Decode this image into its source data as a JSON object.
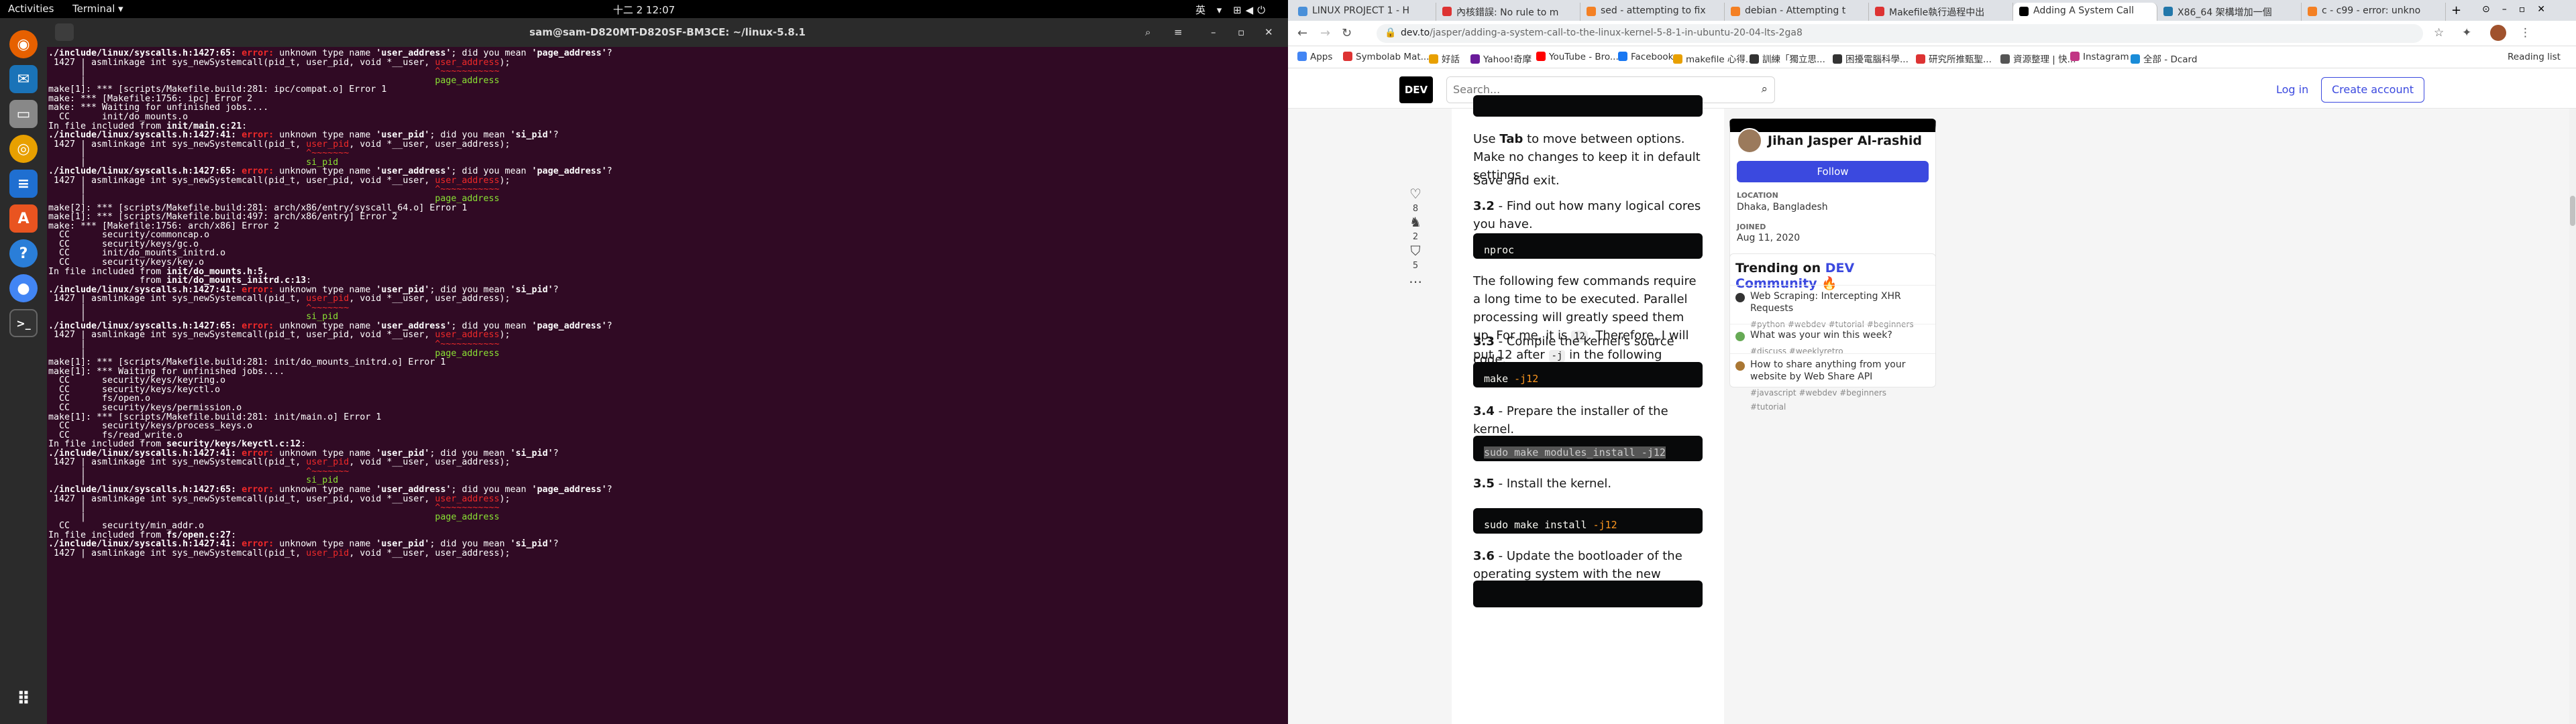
{
  "topbar": {
    "activities": "Activities",
    "app": "Terminal ▾",
    "clock": "十二 2 12:07",
    "input": "英 ▾"
  },
  "terminal": {
    "title": "sam@sam-D820MT-D820SF-BM3CE: ~/linux-5.8.1"
  },
  "browser": {
    "tabs": [
      "LINUX PROJECT 1 - H",
      "內核錯誤: No rule to m",
      "sed - attempting to fix",
      "debian - Attempting t",
      "Makefile執行過程中出",
      "Adding A System Call",
      "X86_64 架構增加一個",
      "c - c99 - error: unkno"
    ],
    "url_domain": "dev.to",
    "url_path": "/jasper/adding-a-system-call-to-the-linux-kernel-5-8-1-in-ubuntu-20-04-lts-2ga8",
    "bookmarks": [
      "Apps",
      "Symbolab Mat...",
      "好話",
      "Yahoo!奇摩",
      "YouTube - Bro...",
      "Facebook",
      "makefile 心得...",
      "訓練「獨立思...",
      "困擾電腦科學...",
      "研究所推甄聖...",
      "資源整理 | 快...",
      "Instagram",
      "全部 - Dcard",
      "Reading list"
    ]
  },
  "dev": {
    "logo": "DEV",
    "search_placeholder": "Search...",
    "login": "Log in",
    "create": "Create account"
  },
  "reactions": {
    "hearts": "8",
    "unicorns": "2",
    "saves": "5"
  },
  "article": {
    "p1a": "Use ",
    "p1b": "Tab",
    "p1c": " to move between options. Make no changes to keep it in default settings.",
    "p2": "Save and exit.",
    "s32n": "3.2",
    "s32": " - Find out how many logical cores you have.",
    "c32": "nproc",
    "p3a": "The following few commands require a long time to be executed. Parallel processing will greatly speed them up. For me, it is ",
    "p3b": "12",
    "p3c": ". Therefore, I will put 12 after ",
    "p3d": "-j",
    "p3e": " in the following commands.",
    "s33n": "3.3",
    "s33": " - Compile the kernel's source code.",
    "c33a": "make ",
    "c33b": "-j12",
    "s34n": "3.4",
    "s34": " - Prepare the installer of the kernel.",
    "c34": "sudo make modules_install -j12",
    "s35n": "3.5",
    "s35": " - Install the kernel.",
    "c35a": "sudo make install ",
    "c35b": "-j12",
    "s36n": "3.6",
    "s36": " - Update the bootloader of the operating system with the new kernel."
  },
  "author": {
    "name": "Jihan Jasper Al-rashid",
    "follow": "Follow",
    "loc_label": "LOCATION",
    "loc": "Dhaka, Bangladesh",
    "joined_label": "JOINED",
    "joined": "Aug 11, 2020"
  },
  "trending": {
    "title_a": "Trending on ",
    "title_b": "DEV Community",
    "title_c": " 🔥",
    "items": [
      {
        "title": "Web Scraping: Intercepting XHR Requests",
        "tags": "#python  #webdev  #tutorial  #beginners"
      },
      {
        "title": "What was your win this week?",
        "tags": "#discuss  #weeklyretro"
      },
      {
        "title": "How to share anything from your website by Web Share API",
        "tags1": "#javascript  #webdev  #beginners",
        "tags2": "#tutorial"
      }
    ]
  }
}
